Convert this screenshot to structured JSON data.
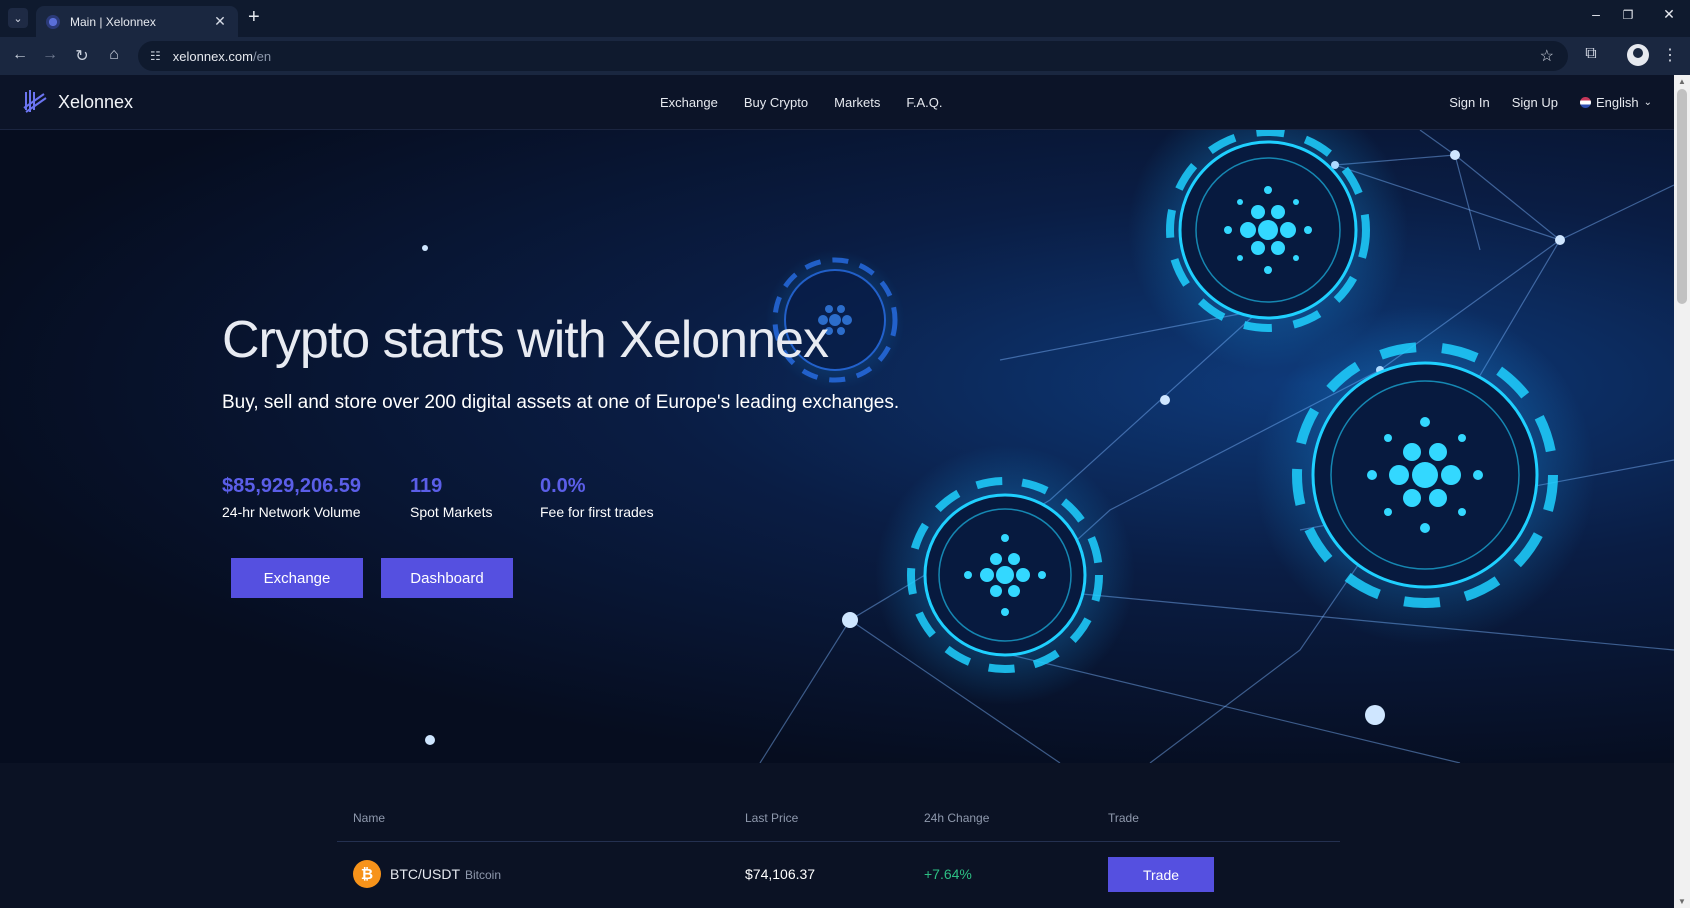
{
  "browser": {
    "tab_title": "Main | Xelonnex",
    "tab_close": "✕",
    "new_tab": "+",
    "url_host": "xelonnex.com",
    "url_path": "/en",
    "window_controls": {
      "minimize": "–",
      "restore": "❐",
      "close": "✕"
    }
  },
  "header": {
    "logo_text": "Xelonnex",
    "nav": [
      "Exchange",
      "Buy Crypto",
      "Markets",
      "F.A.Q."
    ],
    "sign_in": "Sign In",
    "sign_up": "Sign Up",
    "language": "English"
  },
  "hero": {
    "title": "Crypto starts with Xelonnex",
    "subtitle": "Buy, sell and store over 200 digital assets at one of Europe's leading exchanges.",
    "stats": [
      {
        "value": "$85,929,206.59",
        "label": "24-hr Network Volume"
      },
      {
        "value": "119",
        "label": "Spot Markets"
      },
      {
        "value": "0.0%",
        "label": "Fee for first trades"
      }
    ],
    "buttons": {
      "exchange": "Exchange",
      "dashboard": "Dashboard"
    }
  },
  "markets": {
    "columns": [
      "Name",
      "Last Price",
      "24h Change",
      "Trade"
    ],
    "rows": [
      {
        "icon": "₿",
        "pair": "BTC/USDT",
        "name": "Bitcoin",
        "last_price": "$74,106.37",
        "change": "+7.64%",
        "action": "Trade"
      }
    ]
  },
  "colors": {
    "accent": "#5550e0",
    "positive": "#2dbf84",
    "background": "#0b1224"
  }
}
